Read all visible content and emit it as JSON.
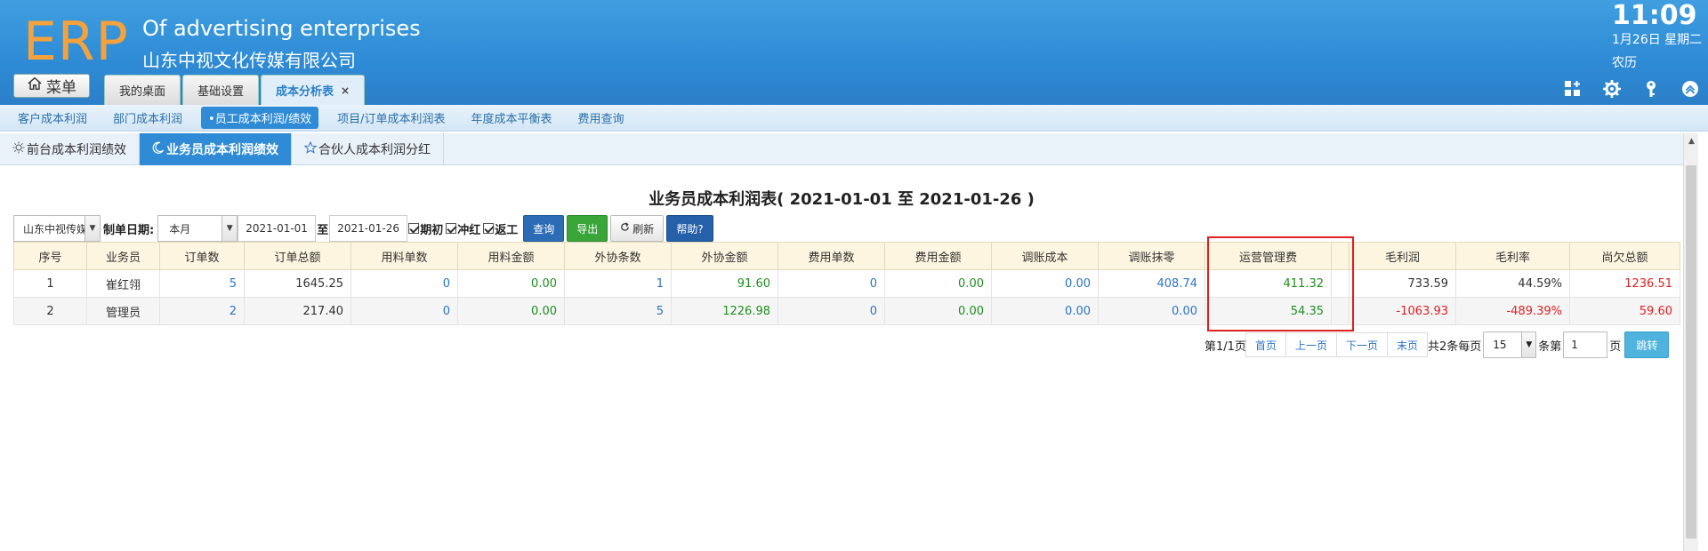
{
  "header": {
    "logo": "ERP",
    "company_en": "Of advertising enterprises",
    "company_cn": "山东中视文化传媒有限公司",
    "time": "11:09",
    "date": "1月26日 星期二",
    "lunar": "农历",
    "menu_label": "菜单",
    "tabs": [
      {
        "label": "我的桌面"
      },
      {
        "label": "基础设置"
      },
      {
        "label": "成本分析表",
        "close": "×"
      }
    ],
    "icons": [
      "grid-plus-icon",
      "gear-icon",
      "key-icon",
      "collapse-up-icon"
    ]
  },
  "subnav": {
    "items": [
      {
        "label": "客户成本利润"
      },
      {
        "label": "部门成本利润"
      },
      {
        "label": "•员工成本利润/绩效"
      },
      {
        "label": "项目/订单成本利润表"
      },
      {
        "label": "年度成本平衡表"
      },
      {
        "label": "费用查询"
      }
    ]
  },
  "innertabs": [
    {
      "label": "前台成本利润绩效",
      "icon": "sun-icon"
    },
    {
      "label": "业务员成本利润绩效",
      "icon": "moon-icon"
    },
    {
      "label": "合伙人成本利润分红",
      "icon": "star-icon"
    }
  ],
  "report": {
    "title": "业务员成本利润表( 2021-01-01 至 2021-01-26 )"
  },
  "filters": {
    "company": "山东中视传媒",
    "date_label": "制单日期:",
    "period": "本月",
    "date_from": "2021-01-01",
    "to_label": "至",
    "date_to": "2021-01-26",
    "chk_opening": "期初",
    "chk_reverse": "冲红",
    "chk_rework": "返工",
    "btn_query": "查询",
    "btn_export": "导出",
    "btn_refresh": "刷新",
    "btn_help": "帮助?"
  },
  "table": {
    "columns": [
      "序号",
      "业务员",
      "订单数",
      "订单总额",
      "用料单数",
      "用料金额",
      "外协条数",
      "外协金额",
      "费用单数",
      "费用金额",
      "调账成本",
      "调账抹零",
      "运营管理费",
      "",
      "毛利润",
      "毛利率",
      "尚欠总额"
    ],
    "rows": [
      [
        "1",
        "崔红翎",
        "5",
        "1645.25",
        "0",
        "0.00",
        "1",
        "91.60",
        "0",
        "0.00",
        "0.00",
        "408.74",
        "411.32",
        "",
        "733.59",
        "44.59%",
        "1236.51"
      ],
      [
        "2",
        "管理员",
        "2",
        "217.40",
        "0",
        "0.00",
        "5",
        "1226.98",
        "0",
        "0.00",
        "0.00",
        "0.00",
        "54.35",
        "",
        "-1063.93",
        "-489.39%",
        "59.60"
      ]
    ]
  },
  "pager": {
    "page_info": "第1/1页",
    "first": "首页",
    "prev": "上一页",
    "next": "下一页",
    "last": "末页",
    "total": "共2条每页",
    "page_size": "15",
    "unit": "条第",
    "current": "1",
    "page_suffix": "页",
    "go": "跳转"
  }
}
